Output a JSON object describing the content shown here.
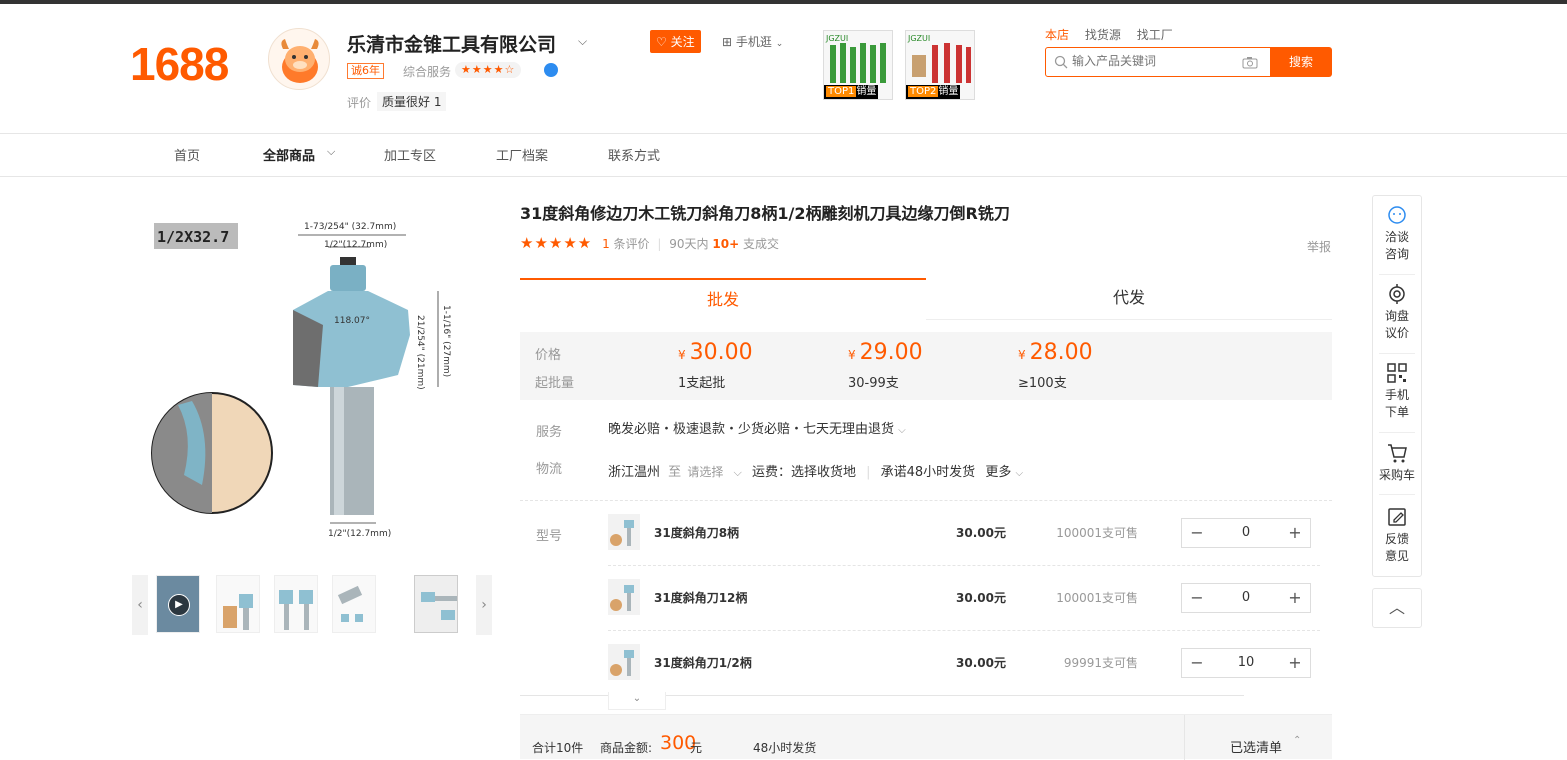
{
  "header": {
    "logo": "1688",
    "shop_name": "乐清市金锥工具有限公司",
    "year_badge": "诚6年",
    "service_label": "综合服务",
    "service_stars": "★★★★☆",
    "rate_label": "评价",
    "rate_value": "质量很好 1",
    "follow": "关注",
    "mobile_shop": "手机逛",
    "top_products": [
      {
        "rank": "TOP1",
        "label": "销量"
      },
      {
        "rank": "TOP2",
        "label": "销量"
      }
    ],
    "search_tabs": [
      "本店",
      "找货源",
      "找工厂"
    ],
    "search_placeholder": "输入产品关键词",
    "search_button": "搜索"
  },
  "nav": {
    "items": [
      "首页",
      "全部商品",
      "加工专区",
      "工厂档案",
      "联系方式"
    ]
  },
  "gallery": {
    "size_label": "1/2X32.7",
    "dims": {
      "top_width": "1-73/254\" (32.7mm)",
      "bearing": "1/2\"(12.7mm)",
      "angle": "118.07°",
      "height_a": "1-1/16\" (27mm)",
      "height_b": "21/254\" (21mm)",
      "shank": "1/2\"(12.7mm)"
    }
  },
  "product": {
    "title": "31度斜角修边刀木工铣刀斜角刀8柄1/2柄雕刻机刀具边缘刀倒R铣刀",
    "stars": "★★★★★",
    "review_count": "1",
    "review_label": "条评价",
    "deals_prefix": "90天内",
    "deals_count": "10+",
    "deals_suffix": "支成交",
    "report": "举报"
  },
  "tabs": {
    "wholesale": "批发",
    "dropship": "代发"
  },
  "pricing": {
    "price_label": "价格",
    "moq_label": "起批量",
    "currency": "¥",
    "tiers": [
      {
        "price": "30.00",
        "qty": "1支起批"
      },
      {
        "price": "29.00",
        "qty": "30-99支"
      },
      {
        "price": "28.00",
        "qty": "≥100支"
      }
    ]
  },
  "service": {
    "label": "服务",
    "text": "晚发必赔・极速退款・少货必赔・七天无理由退货",
    "logistics_label": "物流",
    "origin": "浙江温州",
    "to": "至",
    "select": "请选择",
    "freight": "运费：选择收货地",
    "promise": "承诺48小时发货",
    "more": "更多"
  },
  "sku": {
    "label": "型号",
    "items": [
      {
        "name": "31度斜角刀8柄",
        "price": "30.00元",
        "stock": "100001支可售",
        "qty": "0"
      },
      {
        "name": "31度斜角刀12柄",
        "price": "30.00元",
        "stock": "100001支可售",
        "qty": "0"
      },
      {
        "name": "31度斜角刀1/2柄",
        "price": "30.00元",
        "stock": "99991支可售",
        "qty": "10"
      }
    ]
  },
  "summary": {
    "total_qty": "合计10件",
    "amount_label": "商品金额:",
    "amount": "300",
    "unit": "元",
    "ship": "48小时发货",
    "selected": "已选清单"
  },
  "sidebar": {
    "items": [
      "洽谈\n咨询",
      "询盘\n议价",
      "手机\n下单",
      "采购车",
      "反馈\n意见"
    ]
  }
}
